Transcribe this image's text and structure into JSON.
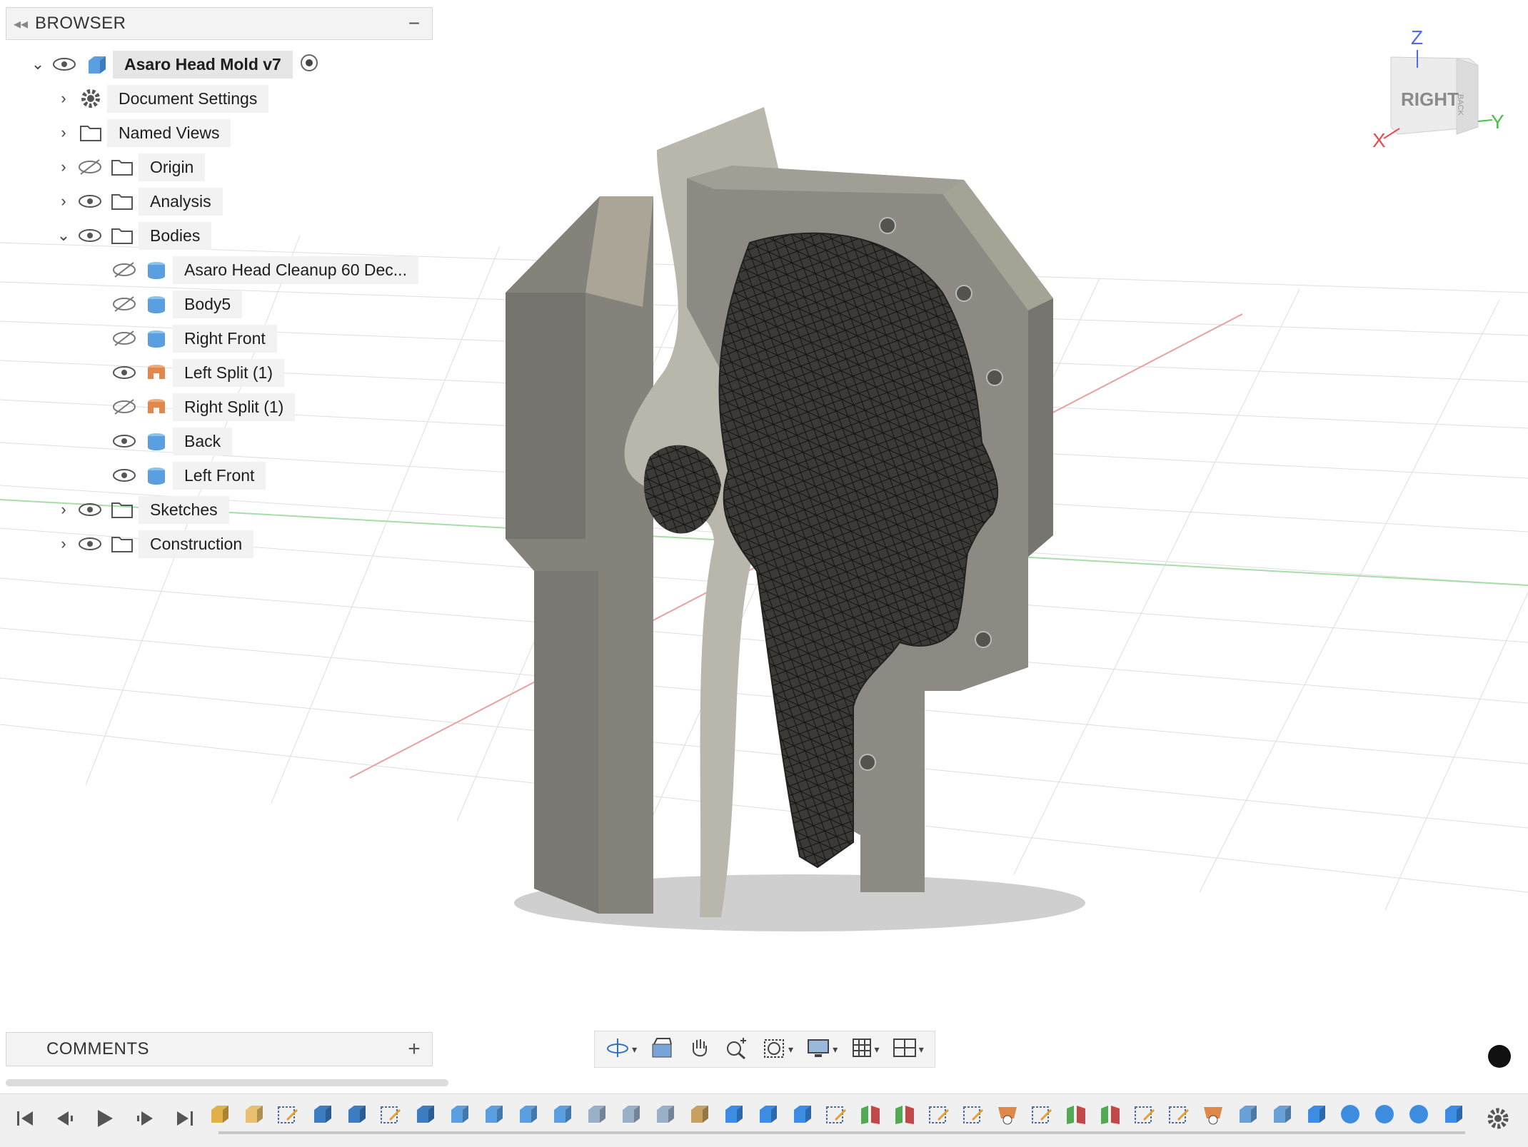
{
  "browser": {
    "title": "BROWSER",
    "document": "Asaro Head Mold v7",
    "items": [
      {
        "label": "Document Settings"
      },
      {
        "label": "Named Views"
      },
      {
        "label": "Origin"
      },
      {
        "label": "Analysis"
      },
      {
        "label": "Bodies"
      },
      {
        "label": "Sketches"
      },
      {
        "label": "Construction"
      }
    ],
    "bodies": [
      {
        "label": "Asaro Head Cleanup 60 Dec...",
        "visible": false,
        "color": "#5aa0e0"
      },
      {
        "label": "Body5",
        "visible": false,
        "color": "#5aa0e0"
      },
      {
        "label": "Right Front",
        "visible": false,
        "color": "#5aa0e0"
      },
      {
        "label": "Left Split (1)",
        "visible": true,
        "color": "#e0884a"
      },
      {
        "label": "Right Split (1)",
        "visible": false,
        "color": "#e0884a"
      },
      {
        "label": "Back",
        "visible": true,
        "color": "#5aa0e0"
      },
      {
        "label": "Left Front",
        "visible": true,
        "color": "#5aa0e0"
      }
    ]
  },
  "comments": {
    "title": "COMMENTS"
  },
  "viewcube": {
    "face": "RIGHT",
    "side": "BACK",
    "axis_z": "Z",
    "axis_x": "X",
    "axis_y": "Y"
  },
  "colors": {
    "body_blue": "#5aa0e0",
    "body_orange": "#e0884a",
    "axis_red": "#e84c4c",
    "axis_green": "#4cc24c",
    "axis_blue": "#4c6ce8",
    "mold_grey": "#8a8780"
  },
  "navbar": {
    "tools": [
      "orbit-icon",
      "look-at-icon",
      "pan-icon",
      "zoom-icon",
      "fit-icon",
      "display-settings-icon",
      "grid-icon",
      "viewports-icon"
    ]
  },
  "timeline": {
    "controls": [
      "go-to-start",
      "step-back",
      "play",
      "step-forward",
      "go-to-end"
    ]
  }
}
